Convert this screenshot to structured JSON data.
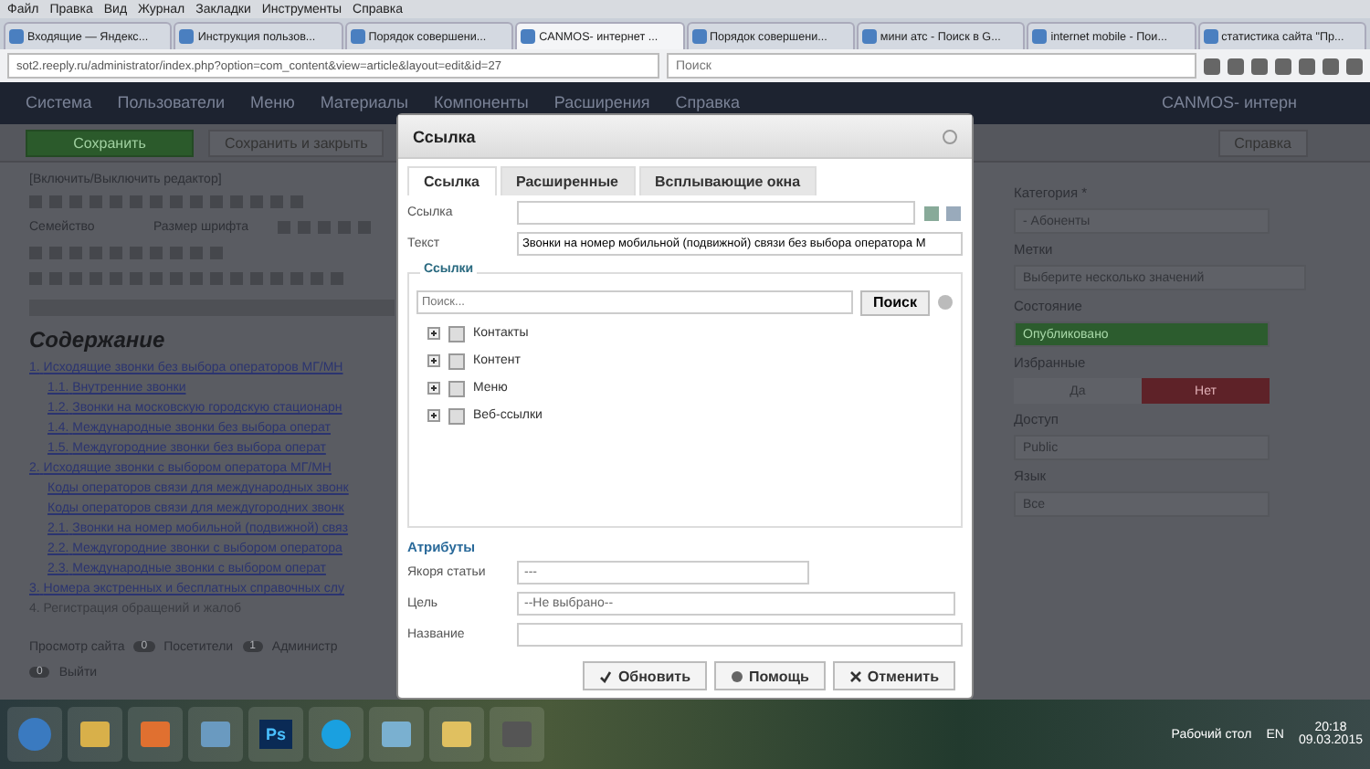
{
  "browser": {
    "menu": [
      "Файл",
      "Правка",
      "Вид",
      "Журнал",
      "Закладки",
      "Инструменты",
      "Справка"
    ],
    "tabs": [
      {
        "title": "Входящие — Яндекс...",
        "selected": false
      },
      {
        "title": "Инструкция пользов...",
        "selected": false
      },
      {
        "title": "Порядок совершени...",
        "selected": false
      },
      {
        "title": "CANMOS- интернет ...",
        "selected": true
      },
      {
        "title": "Порядок совершени...",
        "selected": false
      },
      {
        "title": "мини атс - Поиск в G...",
        "selected": false
      },
      {
        "title": "internet mobile - Пои...",
        "selected": false
      },
      {
        "title": "статистика сайта \"Пр...",
        "selected": false
      }
    ],
    "address": "sot2.reeply.ru/administrator/index.php?option=com_content&view=article&layout=edit&id=27",
    "search_placeholder": "Поиск"
  },
  "app": {
    "nav": [
      "Система",
      "Пользователи",
      "Меню",
      "Материалы",
      "Компоненты",
      "Расширения",
      "Справка"
    ],
    "site_title": "CANMOS- интерн",
    "toolbar": {
      "save": "Сохранить",
      "save_close": "Сохранить и закрыть",
      "help": "Справка"
    },
    "editor": {
      "toggle": "[Включить/Выключить редактор]",
      "font_family": "Семейство",
      "font_size": "Размер шрифта",
      "heading": "Содержание",
      "outline": [
        {
          "number": "1.",
          "text": "Исходящие звонки без выбора операторов МГ/МН",
          "children": [
            {
              "number": "1.1.",
              "text": "Внутренние звонки"
            },
            {
              "number": "1.2.",
              "text": "Звонки на московскую городскую стационарн"
            },
            {
              "number": "1.4.",
              "text": "Международные звонки без выбора операт"
            },
            {
              "number": "1.5.",
              "text": "Междугородние звонки без выбора операт"
            }
          ]
        },
        {
          "number": "2.",
          "text": "Исходящие звонки с выбором оператора МГ/МН",
          "notes": [
            "Коды операторов связи для международных звонк",
            "Коды операторов связи для междугородних звонк"
          ],
          "children": [
            {
              "number": "2.1.",
              "text": "Звонки на номер мобильной (подвижной) связ"
            },
            {
              "number": "2.2.",
              "text": "Междугородние звонки с выбором оператора"
            },
            {
              "number": "2.3.",
              "text": "Международные звонки с выбором операт"
            }
          ]
        },
        {
          "number": "3.",
          "text": "Номера экстренных и бесплатных справочных слу"
        },
        {
          "number": "4.",
          "text": "Регистрация обращений и жалоб"
        }
      ]
    },
    "sidebar": [
      {
        "kind": "select",
        "label": "Категория *",
        "value": "- Абоненты"
      },
      {
        "kind": "tags",
        "label": "Метки",
        "placeholder": "Выберите несколько значений"
      },
      {
        "kind": "status",
        "label": "Состояние",
        "value": "Опубликовано"
      },
      {
        "kind": "toggle",
        "label": "Избранные",
        "options": [
          {
            "label": "Да",
            "selected": false
          },
          {
            "label": "Нет",
            "selected": true
          }
        ]
      },
      {
        "kind": "select",
        "label": "Доступ",
        "value": "Public"
      },
      {
        "kind": "select",
        "label": "Язык",
        "value": "Все"
      }
    ],
    "status_bar": [
      [
        {
          "kind": "link",
          "text": "Просмотр сайта"
        },
        {
          "kind": "count",
          "count": "0",
          "text": "Посетители"
        },
        {
          "kind": "count",
          "count": "1",
          "text": "Администр"
        }
      ],
      [
        {
          "kind": "count",
          "count": "0",
          "text": "Выйти"
        }
      ]
    ]
  },
  "dialog": {
    "title": "Ссылка",
    "tabs": [
      {
        "label": "Ссылка",
        "selected": true
      },
      {
        "label": "Расширенные",
        "selected": false
      },
      {
        "label": "Всплывающие окна",
        "selected": false
      }
    ],
    "link_label": "Ссылка",
    "text_label": "Текст",
    "text_value": "Звонки на номер мобильной (подвижной) связи без выбора оператора М",
    "links": {
      "legend": "Ссылки",
      "search_placeholder": "Поиск...",
      "search_button": "Поиск",
      "tree": [
        {
          "label": "Контакты",
          "expanded": false
        },
        {
          "label": "Контент",
          "expanded": false
        },
        {
          "label": "Меню",
          "expanded": false
        },
        {
          "label": "Веб-ссылки",
          "expanded": false
        }
      ]
    },
    "attributes": {
      "title": "Атрибуты",
      "anchor_label": "Якоря статьи",
      "anchor_value": "---",
      "target_label": "Цель",
      "target_value": "--Не выбрано--",
      "name_label": "Название"
    },
    "buttons": [
      {
        "kind": "update",
        "label": "Обновить"
      },
      {
        "kind": "help",
        "label": "Помощь"
      },
      {
        "kind": "cancel",
        "label": "Отменить"
      }
    ]
  },
  "taskbar": {
    "apps": [
      {
        "kind": "folder"
      },
      {
        "kind": "browser"
      },
      {
        "kind": "network"
      },
      {
        "kind": "photoshop",
        "label": "Ps"
      },
      {
        "kind": "skype"
      },
      {
        "kind": "notepad"
      },
      {
        "kind": "explorer"
      },
      {
        "kind": "video"
      }
    ],
    "desktop_label": "Рабочий стол",
    "language": "EN",
    "time": "20:18",
    "date": "09.03.2015"
  }
}
